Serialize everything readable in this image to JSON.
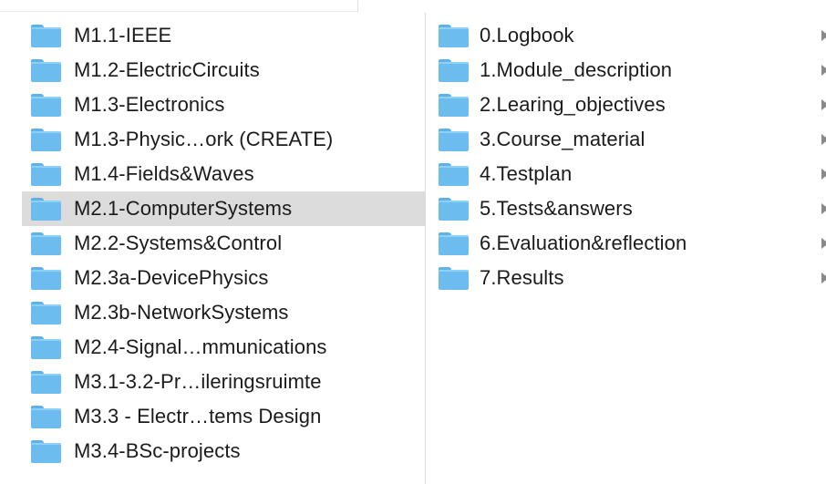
{
  "left_column": {
    "items": [
      {
        "label": "M1.1-IEEE",
        "icon": "folder-icon"
      },
      {
        "label": "M1.2-ElectricCircuits",
        "icon": "folder-icon"
      },
      {
        "label": "M1.3-Electronics",
        "icon": "folder-icon"
      },
      {
        "label": "M1.3-Physic…ork (CREATE)",
        "icon": "folder-icon"
      },
      {
        "label": "M1.4-Fields&Waves",
        "icon": "folder-icon"
      },
      {
        "label": "M2.1-ComputerSystems",
        "icon": "folder-icon",
        "selected": true
      },
      {
        "label": "M2.2-Systems&Control",
        "icon": "folder-icon"
      },
      {
        "label": "M2.3a-DevicePhysics",
        "icon": "folder-icon"
      },
      {
        "label": "M2.3b-NetworkSystems",
        "icon": "folder-icon"
      },
      {
        "label": "M2.4-Signal…mmunications",
        "icon": "folder-icon"
      },
      {
        "label": "M3.1-3.2-Pr…ileringsruimte",
        "icon": "folder-icon"
      },
      {
        "label": "M3.3 - Electr…tems Design",
        "icon": "folder-icon"
      },
      {
        "label": "M3.4-BSc-projects",
        "icon": "folder-icon"
      }
    ]
  },
  "right_column": {
    "items": [
      {
        "label": "0.Logbook",
        "icon": "folder-icon"
      },
      {
        "label": "1.Module_description",
        "icon": "folder-icon"
      },
      {
        "label": "2.Learing_objectives",
        "icon": "folder-icon"
      },
      {
        "label": "3.Course_material",
        "icon": "folder-icon"
      },
      {
        "label": "4.Testplan",
        "icon": "folder-icon"
      },
      {
        "label": "5.Tests&answers",
        "icon": "folder-icon"
      },
      {
        "label": "6.Evaluation&reflection",
        "icon": "folder-icon"
      },
      {
        "label": "7.Results",
        "icon": "folder-icon"
      }
    ]
  },
  "colors": {
    "folder": "#6cbcef",
    "selection": "#dcdcdc",
    "chevron": "#8a8a8a",
    "text": "#1b1b1b"
  }
}
